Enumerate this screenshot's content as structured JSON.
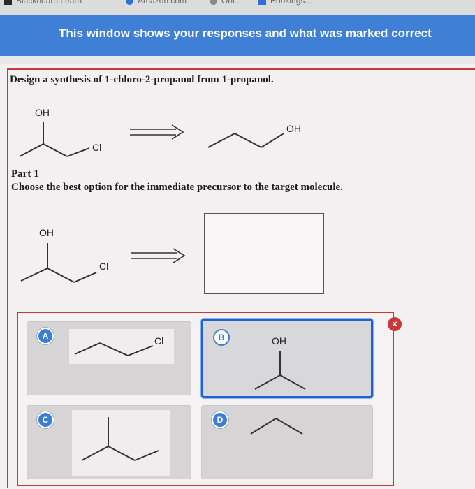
{
  "browser_tabs": [
    {
      "label": "Blackboard Learn",
      "icon": "blackboard-icon",
      "color": "#2a2a2a"
    },
    {
      "label": "Amazon.com",
      "icon": "amazon-icon",
      "color": "#2f6fd6"
    },
    {
      "label": "Onl...",
      "icon": "tab-icon",
      "color": "#555555"
    },
    {
      "label": "Bookings...",
      "icon": "bookings-icon",
      "color": "#2f6fd6"
    }
  ],
  "banner": {
    "text": "This window shows your responses and what was marked correct",
    "color": "#3f80d6"
  },
  "question": {
    "text": "Design a synthesis of 1-chloro-2-propanol from 1-propanol.",
    "target_labels": {
      "oh": "OH",
      "cl": "Cl"
    },
    "starting_label": "OH"
  },
  "part": {
    "title": "Part 1",
    "prompt": "Choose the best option for the immediate precursor to the target molecule.",
    "target_labels": {
      "oh": "OH",
      "cl": "Cl"
    }
  },
  "options": [
    {
      "letter": "A",
      "label": "Cl",
      "selected": false
    },
    {
      "letter": "B",
      "label": "OH",
      "selected": true
    },
    {
      "letter": "C",
      "label": "",
      "selected": false
    },
    {
      "letter": "D",
      "label": "",
      "selected": false
    }
  ],
  "result": {
    "status": "incorrect",
    "icon": "close-icon",
    "symbol": "×",
    "color": "#c8383b"
  }
}
